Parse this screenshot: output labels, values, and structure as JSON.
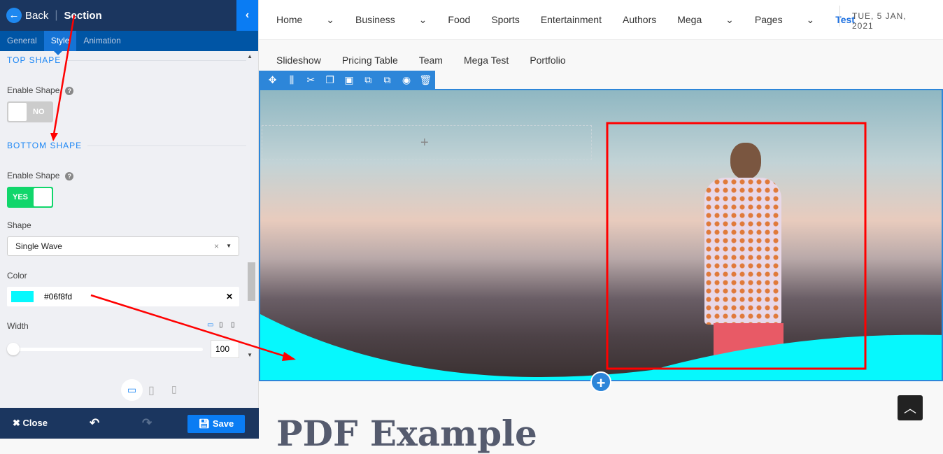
{
  "sidebar": {
    "back": "Back",
    "title": "Section",
    "tabs": [
      "General",
      "Style",
      "Animation"
    ],
    "top_shape": {
      "heading": "TOP SHAPE",
      "enable_label": "Enable Shape",
      "toggle": "NO"
    },
    "bottom_shape": {
      "heading": "BOTTOM SHAPE",
      "enable_label": "Enable Shape",
      "toggle": "YES",
      "shape_label": "Shape",
      "shape_value": "Single Wave",
      "color_label": "Color",
      "color_value": "#06f8fd",
      "width_label": "Width",
      "width_value": "100"
    },
    "footer": {
      "close": "Close",
      "save": "Save"
    }
  },
  "nav": {
    "items": [
      "Home",
      "Business",
      "Food",
      "Sports",
      "Entertainment",
      "Authors",
      "Mega",
      "Pages",
      "Test"
    ],
    "date": "TUE, 5 JAN, 2021",
    "sub": [
      "Slideshow",
      "Pricing Table",
      "Team",
      "Mega Test",
      "Portfolio"
    ]
  },
  "content": {
    "heading": "PDF Example"
  },
  "colors": {
    "wave": "#06f8fd",
    "accent": "#2d86d9"
  }
}
